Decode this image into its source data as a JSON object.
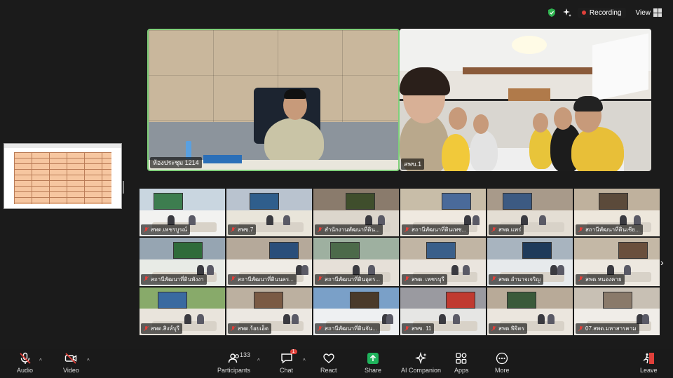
{
  "status": {
    "recording_label": "Recording",
    "view_label": "View"
  },
  "speaker": {
    "name": "ห้องประชุม 1214"
  },
  "room2": {
    "name": "สพข.1"
  },
  "gallery": [
    {
      "name": "สพด.เพชรบูรณ์"
    },
    {
      "name": "สพข.7"
    },
    {
      "name": "สำนักงานพัฒนาที่ดิน..."
    },
    {
      "name": "สถานีพัฒนาที่ดินเพช..."
    },
    {
      "name": "สพด.แพร่"
    },
    {
      "name": "สถานีพัฒนาที่ดินเชีย..."
    },
    {
      "name": "สถานีพัฒนาที่ดินพังงา"
    },
    {
      "name": "สถานีพัฒนาที่ดินนคร..."
    },
    {
      "name": "สถานีพัฒนาที่ดินอุตร..."
    },
    {
      "name": "สพด. เพชรบุรี"
    },
    {
      "name": "สพด.อำนาจเจริญ"
    },
    {
      "name": "สพด.หนองคาย"
    },
    {
      "name": "สพด.สิงห์บุรี"
    },
    {
      "name": "สพด.ร้อยเอ็ด"
    },
    {
      "name": "สถานีพัฒนาที่ดินจัน..."
    },
    {
      "name": "สพข. 11"
    },
    {
      "name": "สพด.พิจิตร"
    },
    {
      "name": "07.สพด.มหาสารคาม"
    }
  ],
  "toolbar": {
    "audio": "Audio",
    "video": "Video",
    "participants": "Participants",
    "participants_count": "133",
    "chat": "Chat",
    "chat_badge": "1",
    "react": "React",
    "share": "Share",
    "ai_companion": "AI Companion",
    "apps": "Apps",
    "more": "More",
    "leave": "Leave"
  },
  "colors": {
    "active_speaker_border": "#7fd07a",
    "share_green": "#1fb35c",
    "muted_red": "#e0403a"
  }
}
